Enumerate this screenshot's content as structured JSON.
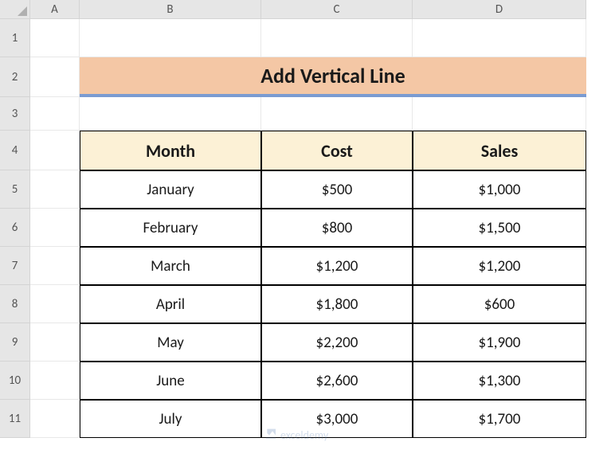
{
  "columns": [
    "A",
    "B",
    "C",
    "D"
  ],
  "rows": [
    "1",
    "2",
    "3",
    "4",
    "5",
    "6",
    "7",
    "8",
    "9",
    "10",
    "11"
  ],
  "title": "Add Vertical Line",
  "headers": {
    "month": "Month",
    "cost": "Cost",
    "sales": "Sales"
  },
  "chart_data": {
    "type": "table",
    "title": "Add Vertical Line",
    "columns": [
      "Month",
      "Cost",
      "Sales"
    ],
    "rows": [
      {
        "month": "January",
        "cost": 500,
        "sales": 1000
      },
      {
        "month": "February",
        "cost": 800,
        "sales": 1500
      },
      {
        "month": "March",
        "cost": 1200,
        "sales": 1200
      },
      {
        "month": "April",
        "cost": 1800,
        "sales": 600
      },
      {
        "month": "May",
        "cost": 2200,
        "sales": 1900
      },
      {
        "month": "June",
        "cost": 2600,
        "sales": 1300
      },
      {
        "month": "July",
        "cost": 3000,
        "sales": 1700
      }
    ]
  },
  "display": {
    "rows": [
      {
        "month": "January",
        "cost": "$500",
        "sales": "$1,000"
      },
      {
        "month": "February",
        "cost": "$800",
        "sales": "$1,500"
      },
      {
        "month": "March",
        "cost": "$1,200",
        "sales": "$1,200"
      },
      {
        "month": "April",
        "cost": "$1,800",
        "sales": "$600"
      },
      {
        "month": "May",
        "cost": "$2,200",
        "sales": "$1,900"
      },
      {
        "month": "June",
        "cost": "$2,600",
        "sales": "$1,300"
      },
      {
        "month": "July",
        "cost": "$3,000",
        "sales": "$1,700"
      }
    ]
  },
  "watermark": "exceldemy"
}
